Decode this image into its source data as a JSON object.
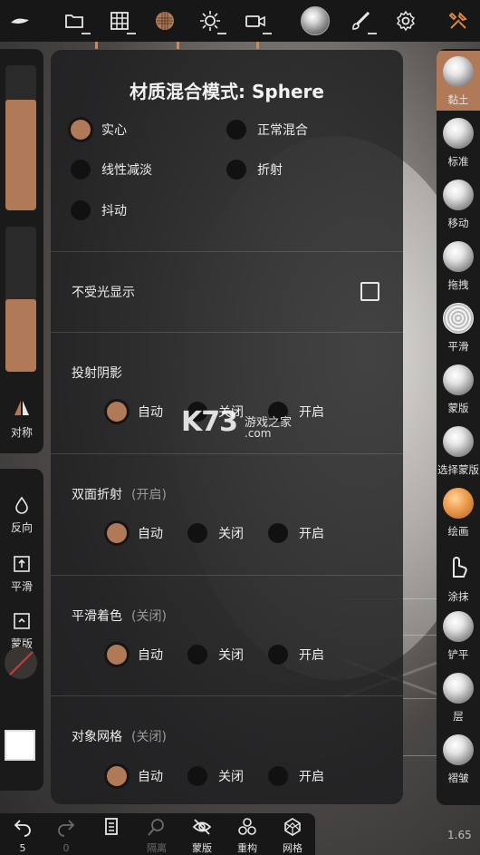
{
  "topbar": {
    "icons": [
      "menu-icon",
      "folder-icon",
      "grid-icon",
      "texture-icon",
      "light-icon",
      "camera-icon",
      "matcap-icon",
      "brush-icon",
      "settings-icon",
      "tools-icon"
    ]
  },
  "left_panel": {
    "symmetry_label": "对称",
    "tools": [
      {
        "label": "反向",
        "icon": "droplet-icon"
      },
      {
        "label": "平滑",
        "icon": "smooth-icon"
      },
      {
        "label": "蒙版",
        "icon": "mask-icon"
      }
    ],
    "slider1_level": 0.76,
    "slider2_level": 0.5
  },
  "dialog": {
    "title": "材质混合模式: Sphere",
    "blend_options": [
      {
        "label": "实心",
        "selected": true
      },
      {
        "label": "正常混合",
        "selected": false
      },
      {
        "label": "线性减淡",
        "selected": false
      },
      {
        "label": "折射",
        "selected": false
      },
      {
        "label": "抖动",
        "selected": false
      }
    ],
    "unlit_label": "不受光显示",
    "sections": [
      {
        "title": "投射阴影",
        "sub": "",
        "options": [
          "自动",
          "关闭",
          "开启"
        ]
      },
      {
        "title": "双面折射",
        "sub": "(开启)",
        "options": [
          "自动",
          "关闭",
          "开启"
        ]
      },
      {
        "title": "平滑着色",
        "sub": "(关闭)",
        "options": [
          "自动",
          "关闭",
          "开启"
        ]
      },
      {
        "title": "对象网格",
        "sub": "(关闭)",
        "options": [
          "自动",
          "关闭",
          "开启"
        ]
      }
    ]
  },
  "right_panel": {
    "tools": [
      {
        "label": "黏土",
        "active": true
      },
      {
        "label": "标准",
        "active": false
      },
      {
        "label": "移动",
        "active": false
      },
      {
        "label": "拖拽",
        "active": false
      },
      {
        "label": "平滑",
        "active": false
      },
      {
        "label": "蒙版",
        "active": false
      },
      {
        "label": "选择蒙版",
        "active": false
      },
      {
        "label": "绘画",
        "active": false
      },
      {
        "label": "涂抹",
        "active": false
      },
      {
        "label": "铲平",
        "active": false
      },
      {
        "label": "层",
        "active": false
      },
      {
        "label": "褶皱",
        "active": false
      }
    ]
  },
  "bottombar": {
    "undo_count": "5",
    "redo_count": "0",
    "items": [
      {
        "label": "隔离",
        "icon": "isolate-icon"
      },
      {
        "label": "蒙版",
        "icon": "hide-icon"
      },
      {
        "label": "重构",
        "icon": "remesh-icon"
      },
      {
        "label": "网格",
        "icon": "wireframe-icon"
      }
    ],
    "version": "1.65"
  },
  "watermark": {
    "brand": "K73",
    "site": "游戏之家",
    "domain": ".com"
  },
  "colors": {
    "accent": "#b07a58",
    "panel": "#1a1a1a",
    "dialog": "#1c1c1e"
  }
}
